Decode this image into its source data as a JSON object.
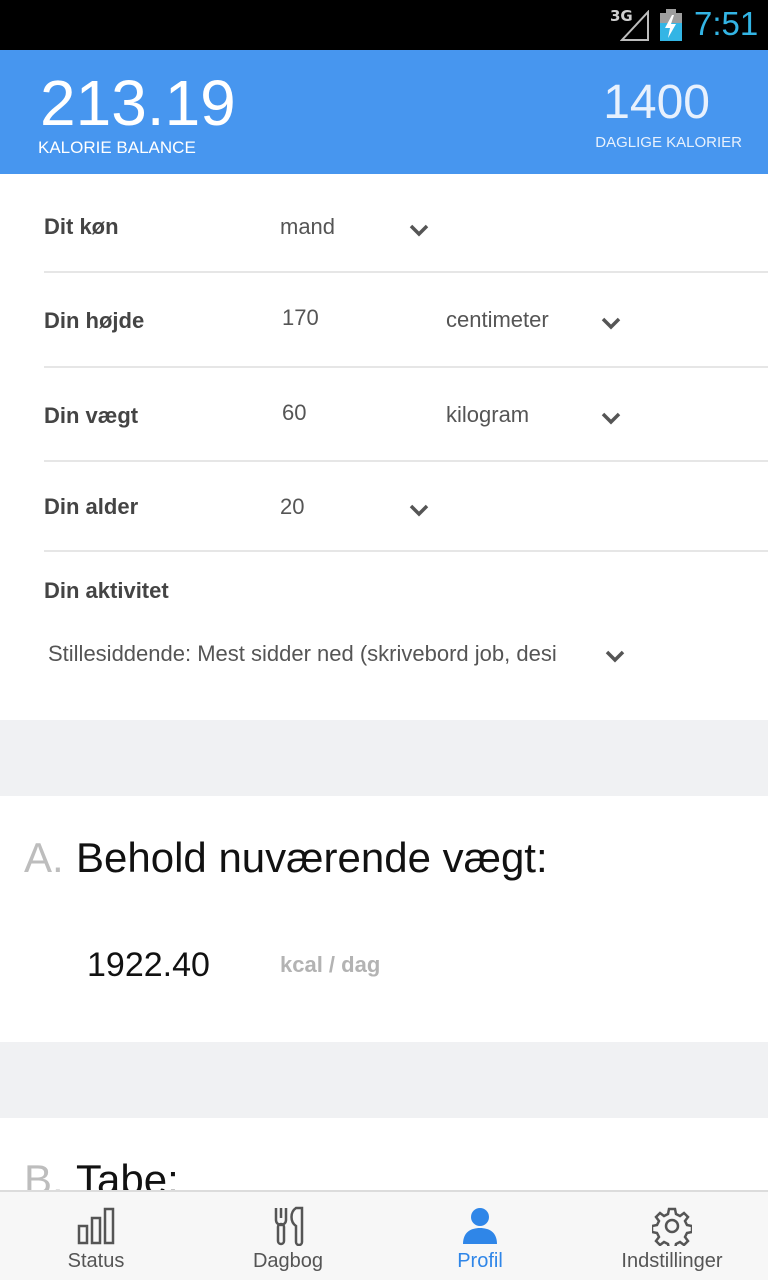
{
  "status_bar": {
    "network": "3G",
    "time": "7:51",
    "time_color": "#33b5e5"
  },
  "header": {
    "balance_value": "213.19",
    "balance_label": "KALORIE BALANCE",
    "daily_value": "1400",
    "daily_label": "DAGLIGE KALORIER",
    "background": "#4796ef"
  },
  "form": {
    "gender": {
      "label": "Dit køn",
      "value": "mand"
    },
    "height": {
      "label": "Din højde",
      "value": "170",
      "unit": "centimeter"
    },
    "weight": {
      "label": "Din vægt",
      "value": "60",
      "unit": "kilogram"
    },
    "age": {
      "label": "Din alder",
      "value": "20"
    },
    "activity": {
      "label": "Din aktivitet",
      "value": "Stillesiddende: Mest sidder ned (skrivebord job, desi"
    }
  },
  "sections": {
    "a": {
      "letter": "A.",
      "title": "Behold nuværende vægt:",
      "kcal_value": "1922.40",
      "kcal_unit": "kcal / dag"
    },
    "b": {
      "letter": "B.",
      "title": "Tabe:"
    }
  },
  "bottom_nav": {
    "items": [
      {
        "label": "Status",
        "icon": "bar-chart-icon"
      },
      {
        "label": "Dagbog",
        "icon": "fork-knife-icon"
      },
      {
        "label": "Profil",
        "icon": "person-icon",
        "active": true
      },
      {
        "label": "Indstillinger",
        "icon": "gear-icon"
      }
    ],
    "active_color": "#2f86e8"
  }
}
